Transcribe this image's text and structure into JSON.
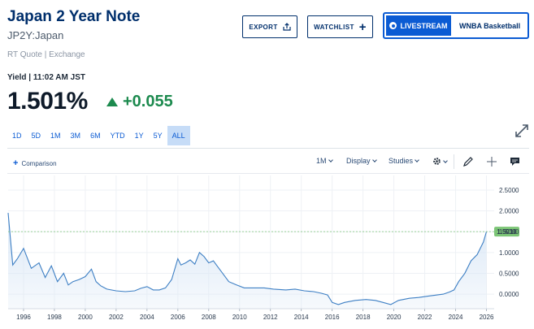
{
  "header": {
    "title": "Japan 2 Year Note",
    "symbol": "JP2Y:Japan",
    "quote_type": "RT Quote | Exchange"
  },
  "actions": {
    "export_label": "EXPORT",
    "watchlist_label": "WATCHLIST",
    "livestream_label": "LIVESTREAM",
    "livestream_show": "WNBA Basketball"
  },
  "quote": {
    "yield_label": "Yield | 11:02 AM JST",
    "price": "1.501%",
    "change": "+0.055",
    "change_color": "#1c8a4e"
  },
  "ranges": [
    "1D",
    "5D",
    "1M",
    "3M",
    "6M",
    "YTD",
    "1Y",
    "5Y",
    "ALL"
  ],
  "active_range": "ALL",
  "toolbar": {
    "comparison_label": "Comparison",
    "interval_label": "1M",
    "display_label": "Display",
    "studies_label": "Studies"
  },
  "chart_data": {
    "type": "area",
    "x": [
      1995.0,
      1995.3,
      1995.6,
      1996.0,
      1996.5,
      1997.0,
      1997.4,
      1997.8,
      1998.2,
      1998.6,
      1998.9,
      1999.2,
      1999.6,
      2000.0,
      2000.4,
      2000.7,
      2001.0,
      2001.4,
      2002.0,
      2002.6,
      2003.2,
      2003.6,
      2004.0,
      2004.4,
      2004.8,
      2005.2,
      2005.6,
      2006.0,
      2006.2,
      2006.5,
      2006.8,
      2007.1,
      2007.4,
      2007.7,
      2008.0,
      2008.3,
      2008.6,
      2008.9,
      2009.3,
      2009.8,
      2010.3,
      2011.0,
      2011.6,
      2012.2,
      2013.0,
      2013.6,
      2014.2,
      2014.8,
      2015.3,
      2015.7,
      2016.0,
      2016.4,
      2016.8,
      2017.5,
      2018.2,
      2018.8,
      2019.3,
      2019.8,
      2020.3,
      2021.0,
      2021.6,
      2022.2,
      2022.8,
      2023.2,
      2023.6,
      2023.9,
      2024.2,
      2024.6,
      2025.0,
      2025.4,
      2025.8,
      2026.0
    ],
    "values": [
      1.95,
      0.7,
      0.85,
      1.1,
      0.62,
      0.75,
      0.4,
      0.68,
      0.3,
      0.5,
      0.22,
      0.3,
      0.35,
      0.42,
      0.6,
      0.3,
      0.2,
      0.12,
      0.08,
      0.06,
      0.08,
      0.14,
      0.18,
      0.1,
      0.1,
      0.15,
      0.35,
      0.85,
      0.7,
      0.75,
      0.82,
      0.72,
      1.0,
      0.9,
      0.75,
      0.8,
      0.65,
      0.5,
      0.3,
      0.22,
      0.15,
      0.15,
      0.15,
      0.12,
      0.1,
      0.12,
      0.08,
      0.06,
      0.02,
      -0.02,
      -0.2,
      -0.25,
      -0.2,
      -0.15,
      -0.13,
      -0.15,
      -0.2,
      -0.25,
      -0.15,
      -0.1,
      -0.08,
      -0.05,
      -0.02,
      0.0,
      0.05,
      0.1,
      0.3,
      0.5,
      0.8,
      0.95,
      1.25,
      1.501
    ],
    "xlim": [
      1995.0,
      2026.5
    ],
    "ylim": [
      -0.35,
      2.85
    ],
    "x_ticks": [
      "1996",
      "1998",
      "2000",
      "2002",
      "2004",
      "2006",
      "2008",
      "2010",
      "2012",
      "2014",
      "2016",
      "2018",
      "2020",
      "2022",
      "2024",
      "2026"
    ],
    "y_ticks": [
      "2.5000",
      "2.0000",
      "1.5000",
      "1.0000",
      "0.5000",
      "0.0000"
    ],
    "last_value_label": "1.5010",
    "last_value": 1.501,
    "line_color": "#3d7fc4",
    "fill_color": "#dbe8f6",
    "label_color": "#7cc576",
    "grid": true
  }
}
